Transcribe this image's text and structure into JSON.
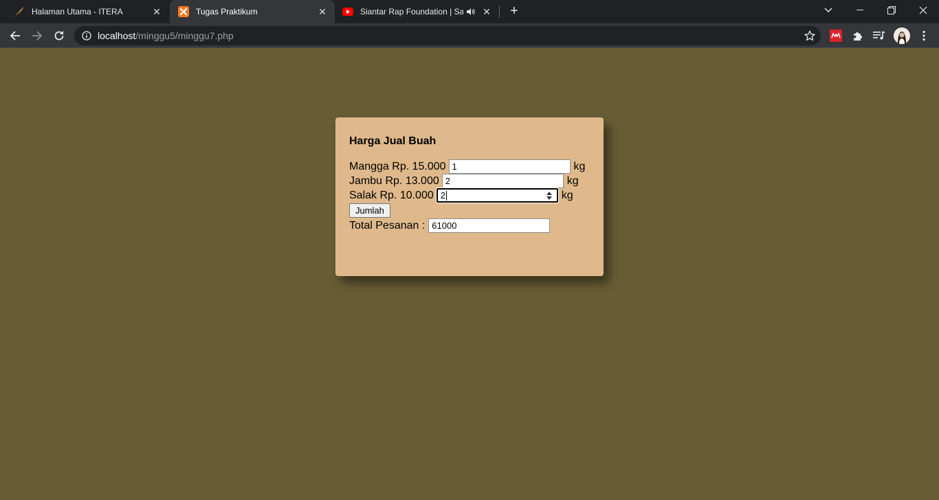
{
  "browser": {
    "tabs": [
      {
        "title": "Halaman Utama - ITERA",
        "favicon": "feather-icon",
        "active": false
      },
      {
        "title": "Tugas Praktikum",
        "favicon": "xampp-icon",
        "active": true
      },
      {
        "title": "Siantar Rap Foundation | Sai",
        "favicon": "youtube-icon",
        "active": false,
        "audio": true
      }
    ],
    "url": {
      "host": "localhost",
      "path": "/minggu5/minggu7.php"
    }
  },
  "form": {
    "heading": "Harga Jual Buah",
    "items": [
      {
        "label": "Mangga Rp. 15.000",
        "value": "1",
        "unit": "kg"
      },
      {
        "label": "Jambu Rp. 13.000",
        "value": "2",
        "unit": "kg"
      },
      {
        "label": "Salak Rp. 10.000",
        "value": "2",
        "unit": "kg"
      }
    ],
    "submit_label": "Jumlah",
    "total_label": "Total Pesanan :",
    "total_value": "61000"
  },
  "colors": {
    "page_background": "#675c34",
    "card_background": "#dfb98b",
    "chrome_dark": "#202124",
    "chrome_toolbar": "#35363a"
  }
}
